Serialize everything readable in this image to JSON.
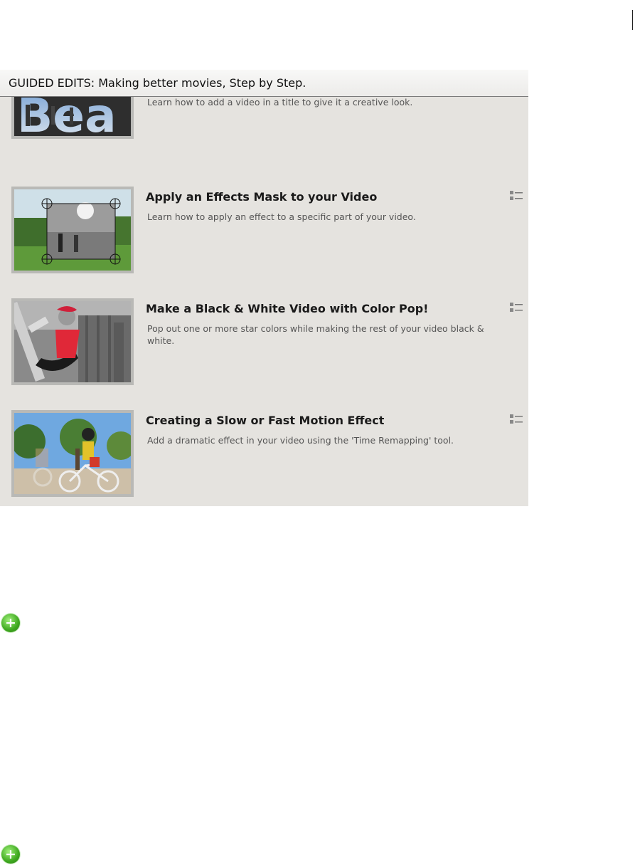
{
  "header": {
    "title": "GUIDED EDITS: Making better movies, Step by Step."
  },
  "items": [
    {
      "title": "",
      "description": "Learn how to add a video in a title to give it a creative look.",
      "thumb_text": "THE Bea"
    },
    {
      "title": "Apply an Effects Mask to your Video",
      "description": "Learn how to apply an effect to a specific part of your video."
    },
    {
      "title": "Make a Black & White Video with Color Pop!",
      "description": "Pop out one or more star colors while making the rest of your video black & white."
    },
    {
      "title": "Creating a Slow or Fast Motion Effect",
      "description": "Add a dramatic effect in your video using the 'Time Remapping' tool."
    }
  ],
  "icons": {
    "list": "list-view-icon",
    "add": "plus-circle-icon"
  },
  "colors": {
    "panel": "#e5e3df",
    "add_green": "#3ea81f"
  },
  "add_buttons": [
    {
      "glyph": "+"
    },
    {
      "glyph": "+"
    }
  ]
}
